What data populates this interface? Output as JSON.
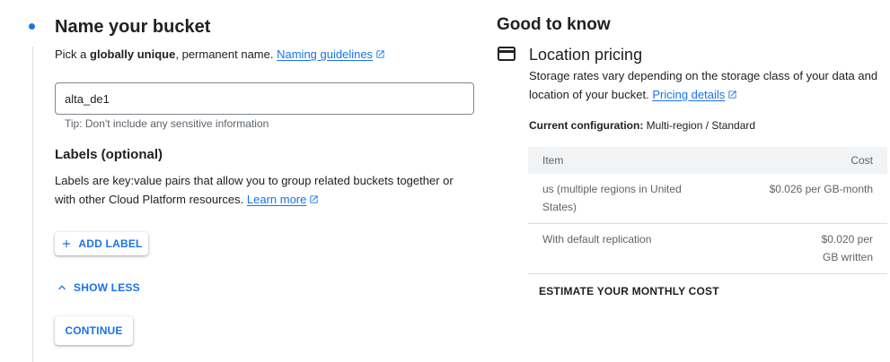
{
  "bucket_section": {
    "title": "Name your bucket",
    "desc_pre": "Pick a ",
    "desc_bold": "globally unique",
    "desc_post": ", permanent name.",
    "naming_link": "Naming guidelines",
    "name_value": "alta_de1",
    "tip": "Tip: Don't include any sensitive information"
  },
  "labels_section": {
    "title": "Labels (optional)",
    "desc_line1": "Labels are key:value pairs that allow you to group related buckets together or",
    "desc_line2": "with other Cloud Platform resources.",
    "learn_more": "Learn more",
    "add_label": "ADD LABEL",
    "show_less": "SHOW LESS",
    "continue": "CONTINUE"
  },
  "good_to_know": {
    "title": "Good to know",
    "pricing_title": "Location pricing",
    "pricing_line1": "Storage rates vary depending on the storage class of your data and",
    "pricing_line2": "location of your bucket.",
    "pricing_link": "Pricing details",
    "config_label": "Current configuration:",
    "config_value": "Multi-region / Standard",
    "table": {
      "col_item": "Item",
      "col_cost": "Cost",
      "rows": [
        {
          "item": "us (multiple regions in United States)",
          "cost": "$0.026 per GB-month"
        },
        {
          "item": "With default replication",
          "cost": "$0.020 per GB written"
        }
      ]
    },
    "estimate": "ESTIMATE YOUR MONTHLY COST"
  },
  "colors": {
    "accent": "#1a73e8",
    "text": "#202124",
    "muted": "#5f6368",
    "divider": "#dadce0"
  },
  "icons": [
    "external-link-icon",
    "add-icon",
    "chevron-up-icon",
    "credit-card-icon"
  ]
}
